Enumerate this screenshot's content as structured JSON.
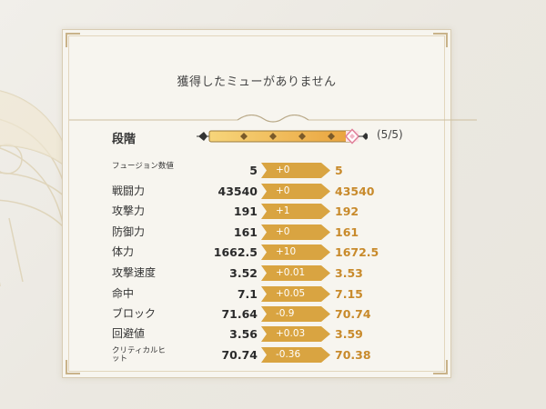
{
  "header": {
    "title": "獲得したミューがありません"
  },
  "stage": {
    "label": "段階",
    "count": "(5/5)",
    "current": 5,
    "max": 5
  },
  "stats": [
    {
      "label": "フュージョン数値",
      "base": "5",
      "delta": "+0",
      "result": "5"
    },
    {
      "label": "戦闘力",
      "base": "43540",
      "delta": "+0",
      "result": "43540"
    },
    {
      "label": "攻撃力",
      "base": "191",
      "delta": "+1",
      "result": "192"
    },
    {
      "label": "防御力",
      "base": "161",
      "delta": "+0",
      "result": "161"
    },
    {
      "label": "体力",
      "base": "1662.5",
      "delta": "+10",
      "result": "1672.5"
    },
    {
      "label": "攻撃速度",
      "base": "3.52",
      "delta": "+0.01",
      "result": "3.53"
    },
    {
      "label": "命中",
      "base": "7.1",
      "delta": "+0.05",
      "result": "7.15"
    },
    {
      "label": "ブロック",
      "base": "71.64",
      "delta": "-0.9",
      "result": "70.74"
    },
    {
      "label": "回避値",
      "base": "3.56",
      "delta": "+0.03",
      "result": "3.59"
    },
    {
      "label": "クリティカルヒット",
      "base": "70.74",
      "delta": "-0.36",
      "result": "70.38"
    }
  ],
  "colors": {
    "accent": "#d9a441",
    "result_text": "#c88a2b"
  }
}
